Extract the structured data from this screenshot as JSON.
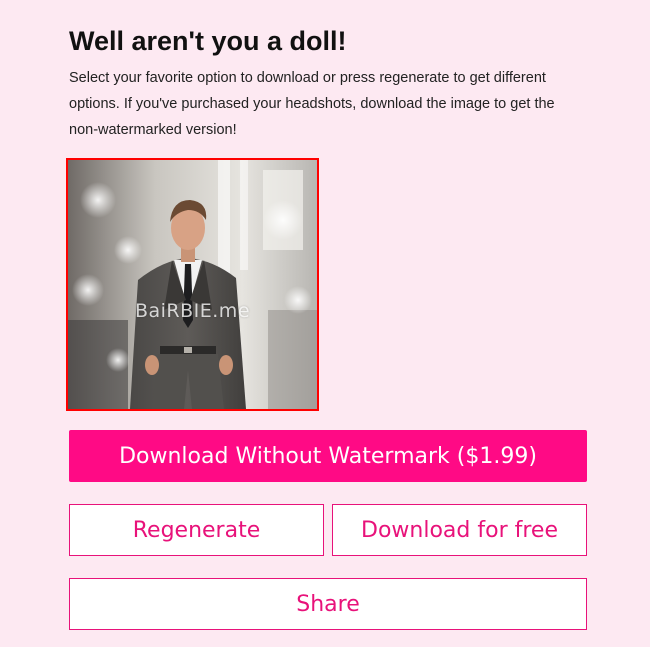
{
  "header": {
    "title": "Well aren't you a doll!",
    "description": "Select your favorite option to download or press regenerate to get different options. If you've purchased your headshots, download the image to get the non-watermarked version!"
  },
  "preview": {
    "watermark": "BaiRBIE.me",
    "image": "man-in-suit-headshot",
    "border_color": "#ff0000"
  },
  "actions": {
    "download_paid_label": "Download Without Watermark ($1.99)",
    "regenerate_label": "Regenerate",
    "download_free_label": "Download for free",
    "share_label": "Share"
  },
  "colors": {
    "background": "#fde9f2",
    "accent": "#ff0a85",
    "outline": "#e8127a"
  }
}
